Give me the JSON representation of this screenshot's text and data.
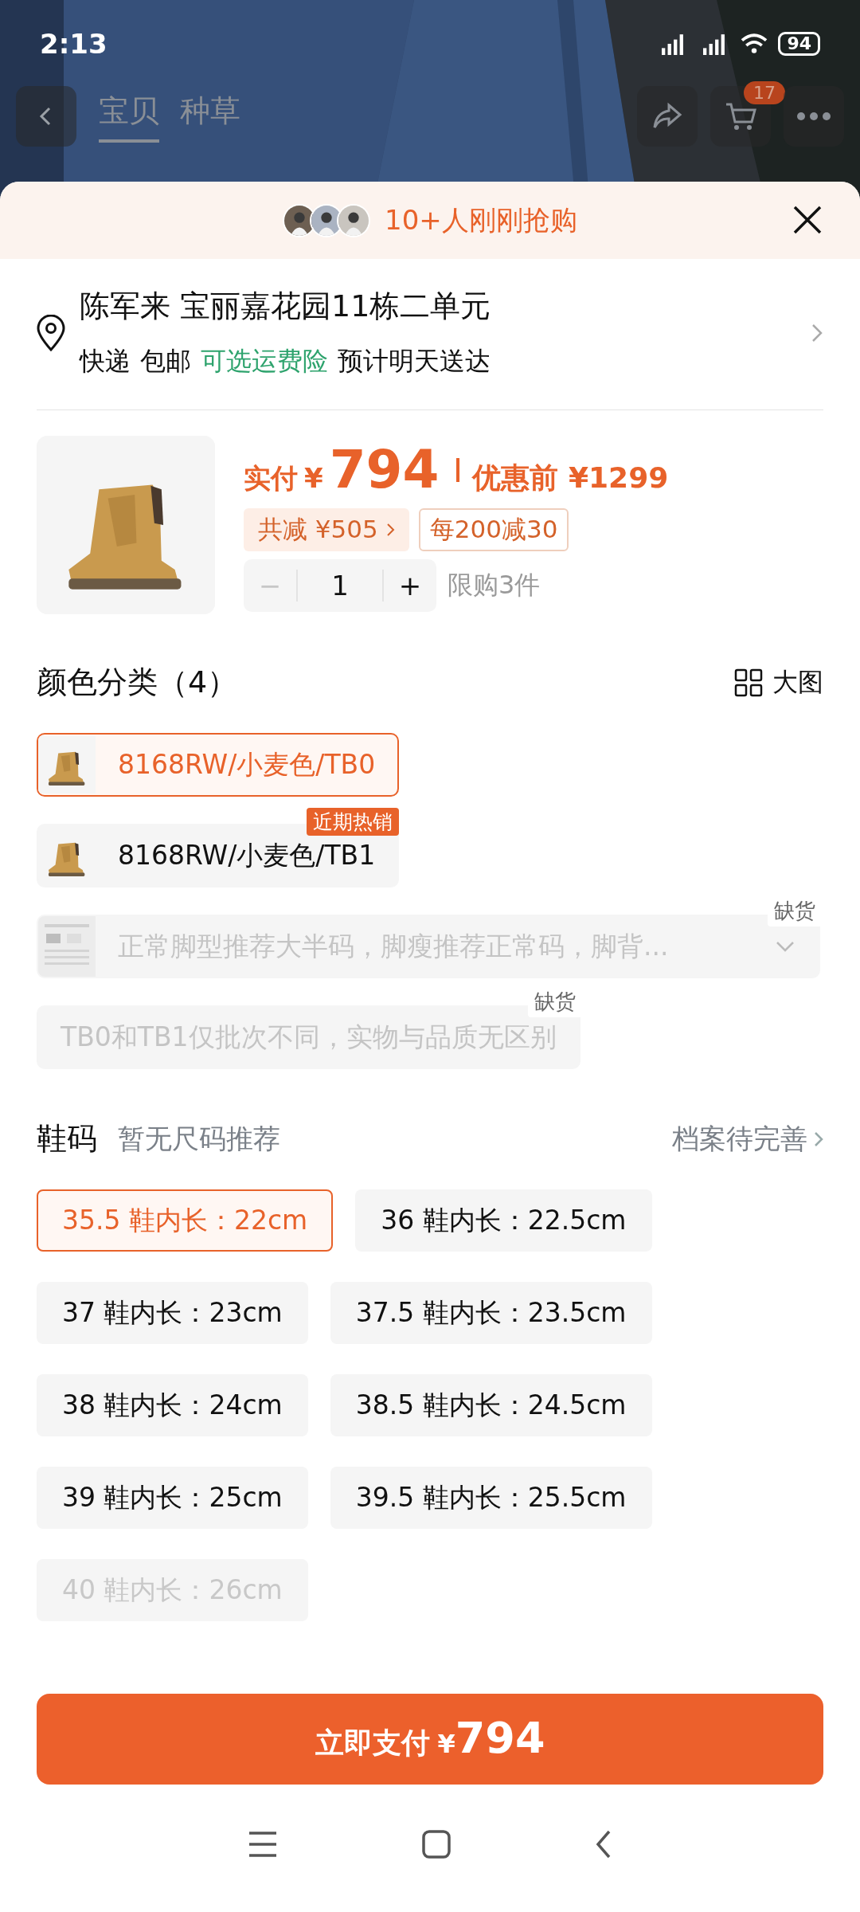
{
  "status_bar": {
    "time": "2:13",
    "battery": "94"
  },
  "nav": {
    "tabs": [
      {
        "label": "宝贝",
        "selected": true
      },
      {
        "label": "种草",
        "selected": false
      }
    ],
    "cart_badge": "17"
  },
  "banner": {
    "text": "10+人刚刚抢购"
  },
  "address": {
    "recipient": "陈军来 宝丽嘉花园11栋二单元",
    "delivery": [
      {
        "text": "快递",
        "kind": "plain"
      },
      {
        "text": "包邮",
        "kind": "plain"
      },
      {
        "text": "可选运费险",
        "kind": "link"
      },
      {
        "text": "预计明天送达",
        "kind": "plain"
      }
    ]
  },
  "product": {
    "price_label": "实付",
    "currency": "¥",
    "price": "794",
    "original_price": "优惠前 ¥1299",
    "discount": "共减 ¥505",
    "coupon": "每200减30",
    "quantity": "1",
    "decrement": "−",
    "increment": "+",
    "decrement_disabled": true,
    "limit": "限购3件"
  },
  "colors": {
    "title": "颜色分类（4）",
    "view_toggle": "大图",
    "options": [
      {
        "label": "8168RW/小麦色/TB0",
        "selected": true,
        "disabled": false
      },
      {
        "label": "8168RW/小麦色/TB1",
        "selected": false,
        "badge": "近期热销",
        "disabled": false
      },
      {
        "kind": "chart",
        "label": "正常脚型推荐大半码，脚瘦推荐正常码，脚背...",
        "selected": false,
        "disabled": true,
        "tag": "缺货",
        "expandable": true
      },
      {
        "kind": "text",
        "label": "TB0和TB1仅批次不同，实物与品质无区别",
        "selected": false,
        "disabled": true,
        "tag": "缺货"
      }
    ]
  },
  "sizes": {
    "title": "鞋码",
    "hint": "暂无尺码推荐",
    "profile_link": "档案待完善",
    "options": [
      {
        "label": "35.5 鞋内长：22cm",
        "selected": true,
        "disabled": false
      },
      {
        "label": "36 鞋内长：22.5cm",
        "selected": false,
        "disabled": false
      },
      {
        "label": "37 鞋内长：23cm",
        "selected": false,
        "disabled": false
      },
      {
        "label": "37.5 鞋内长：23.5cm",
        "selected": false,
        "disabled": false
      },
      {
        "label": "38 鞋内长：24cm",
        "selected": false,
        "disabled": false
      },
      {
        "label": "38.5 鞋内长：24.5cm",
        "selected": false,
        "disabled": false
      },
      {
        "label": "39 鞋内长：25cm",
        "selected": false,
        "disabled": false
      },
      {
        "label": "39.5 鞋内长：25.5cm",
        "selected": false,
        "disabled": false
      },
      {
        "label": "40 鞋内长：26cm",
        "selected": false,
        "disabled": true
      }
    ]
  },
  "pay_button": {
    "label": "立即支付",
    "currency": "¥",
    "amount": "794"
  }
}
